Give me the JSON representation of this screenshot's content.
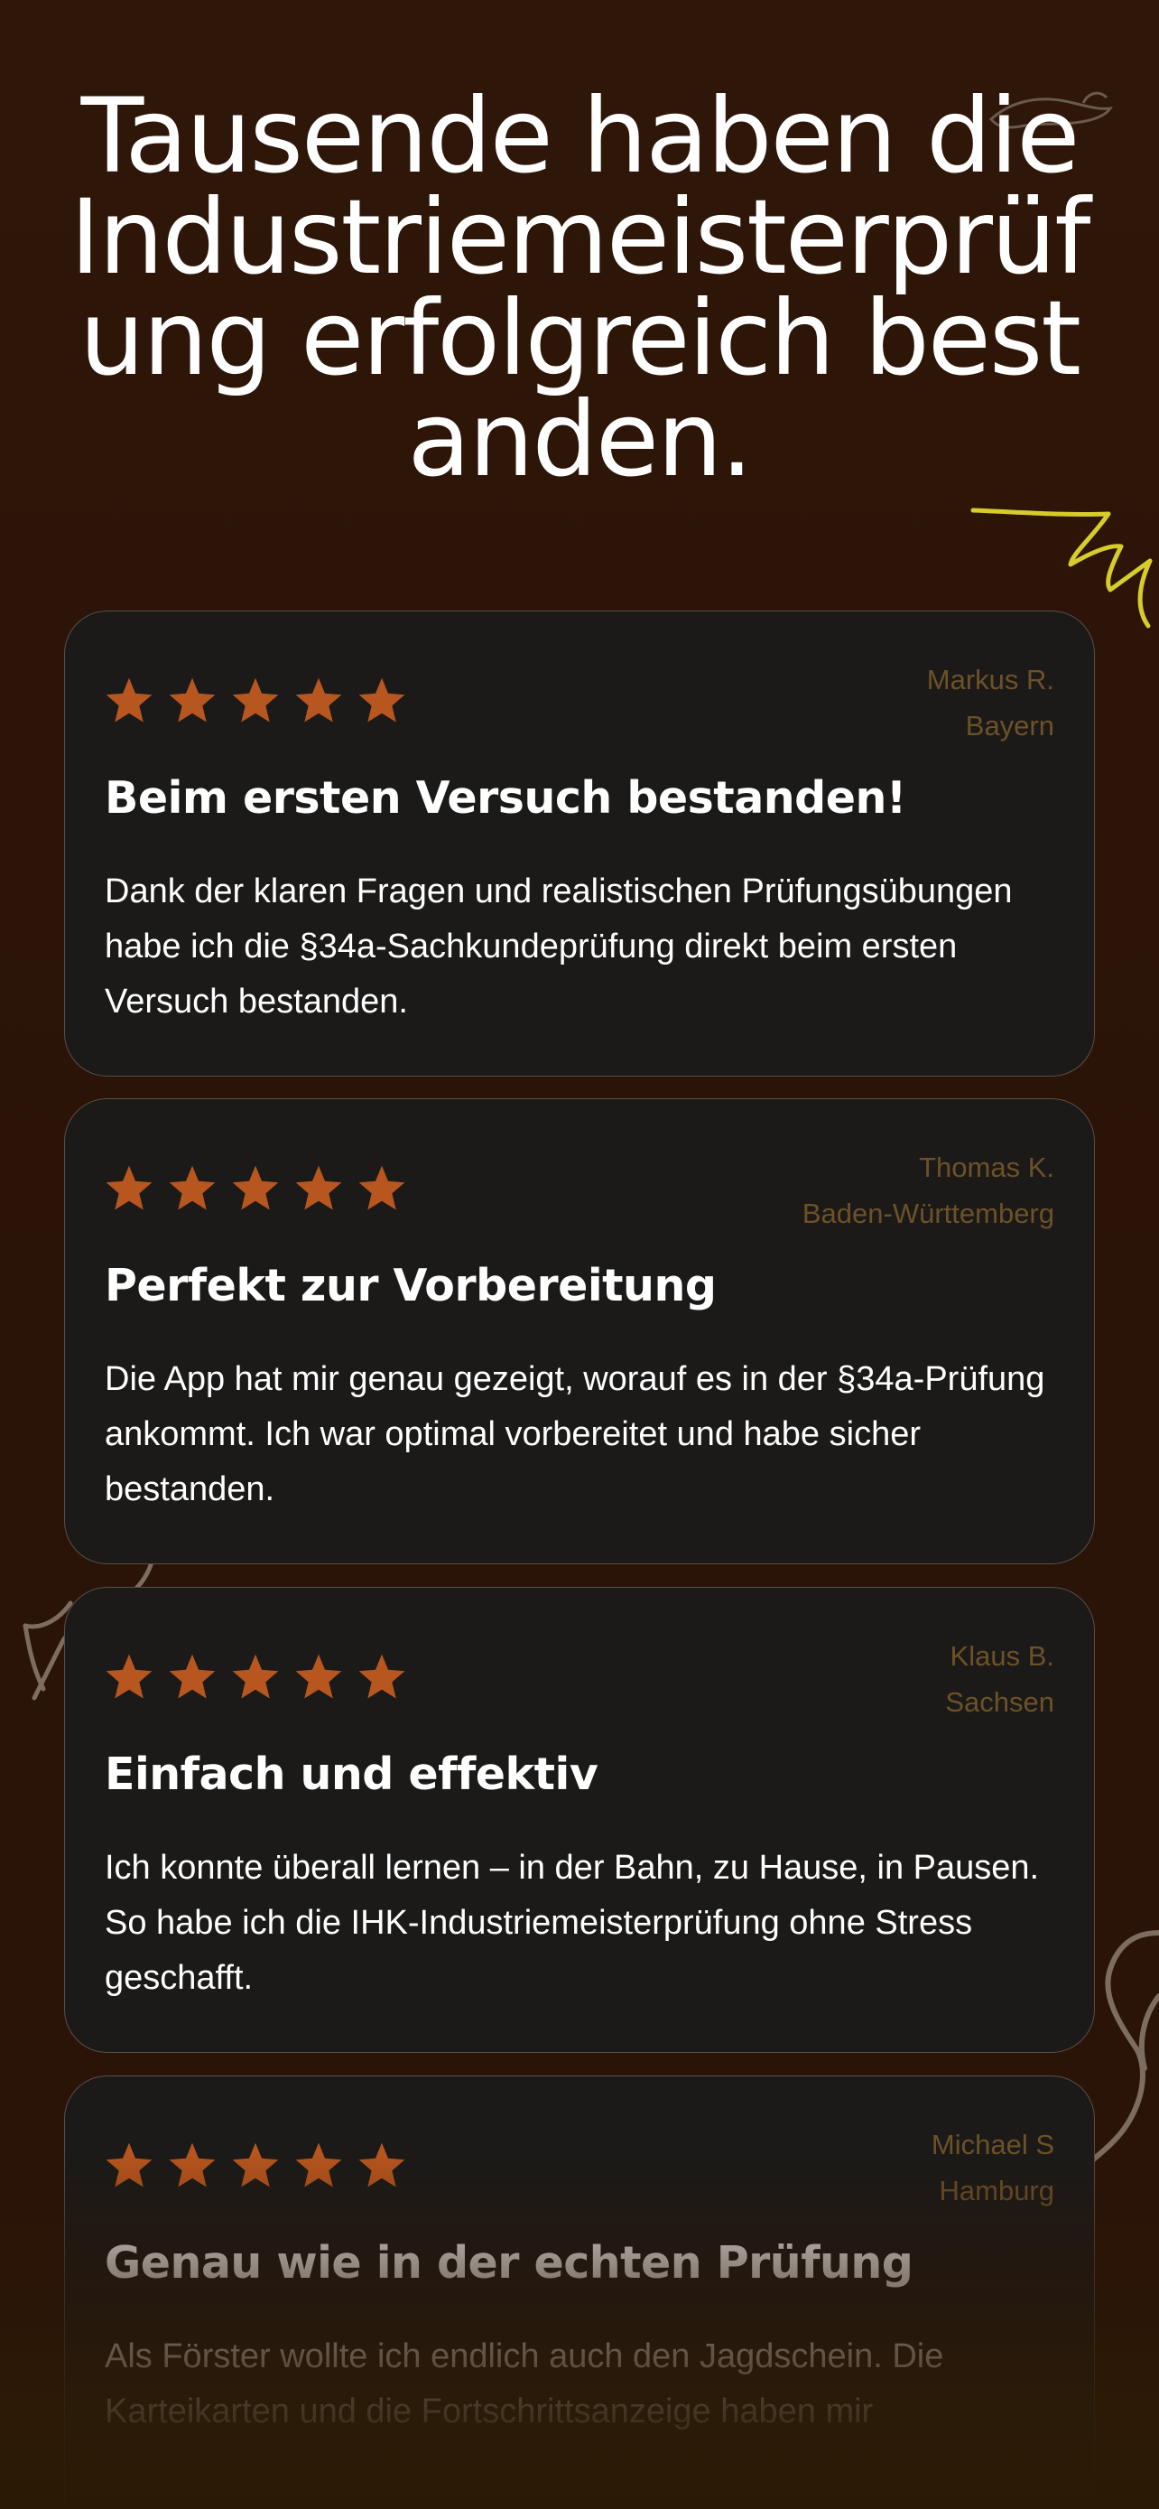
{
  "headline": "Tausende haben die Industriemeisterprüfung erfolgreich bestanden.",
  "colors": {
    "background": "#2c1509",
    "card": "#1b1a19",
    "star": "#b8561f",
    "reviewer": "#6d5128",
    "accent_scribble": "#d6cc2a"
  },
  "reviews": [
    {
      "rating": 5,
      "name": "Markus R.",
      "region": "Bayern",
      "title": "Beim ersten Versuch bestanden!",
      "text": "Dank der klaren Fragen und realistischen Prüfungsübungen habe ich die §34a-Sachkundeprüfung direkt beim ersten Versuch bestanden."
    },
    {
      "rating": 5,
      "name": "Thomas K.",
      "region": "Baden-Württemberg",
      "title": "Perfekt zur Vorbereitung",
      "text": "Die App hat mir genau gezeigt, worauf es in der §34a-Prüfung ankommt. Ich war optimal vorbereitet und habe sicher bestanden."
    },
    {
      "rating": 5,
      "name": "Klaus B.",
      "region": "Sachsen",
      "title": "Einfach und effektiv",
      "text": "Ich konnte überall lernen – in der Bahn, zu Hause, in Pausen. So habe ich die IHK-Industriemeisterprüfung ohne Stress geschafft."
    },
    {
      "rating": 5,
      "name": "Michael S",
      "region": "Hamburg",
      "title": "Genau wie in der echten Prüfung",
      "text": "Als Förster wollte ich endlich auch den Jagdschein. Die Karteikarten und die Fortschrittsanzeige haben mir"
    }
  ]
}
